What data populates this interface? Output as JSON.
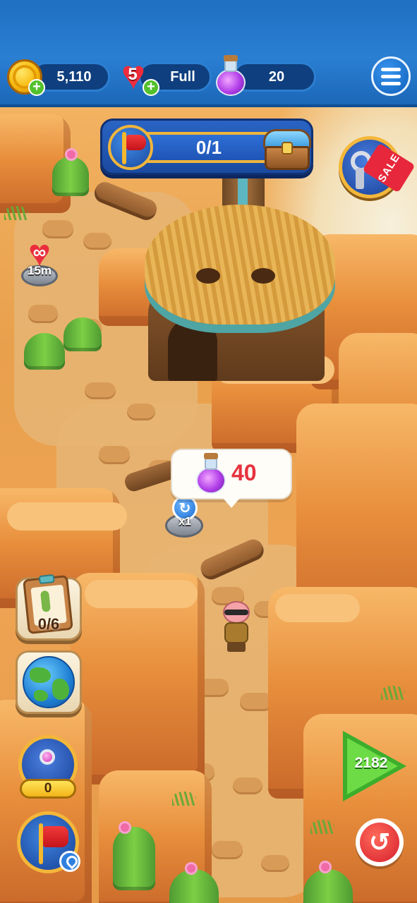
{
  "hud": {
    "coins": "5,110",
    "lives": "5",
    "lives_status": "Full",
    "potions": "20",
    "icons": {
      "coin": "coin-icon",
      "heart": "heart-icon",
      "potion": "potion-icon",
      "menu": "hamburger-menu-icon",
      "add": "plus-icon"
    }
  },
  "quest": {
    "progress": "0/1",
    "icons": {
      "flag": "red-flag-icon",
      "reward": "treasure-chest-icon"
    }
  },
  "sale": {
    "label": "SALE",
    "icon": "keys-icon"
  },
  "unlimited_lives": {
    "symbol": "∞",
    "time": "15m"
  },
  "map_node": {
    "counter": "x1",
    "icon": "refresh-icon"
  },
  "reward_bubble": {
    "amount": "40",
    "icon": "potion-icon"
  },
  "side_buttons": {
    "collection_progress": "0/6",
    "globe_icon": "globe-icon",
    "keys_count": "0",
    "flag_icon": "red-flag-icon",
    "location_icon": "location-pin-icon"
  },
  "play_button": {
    "level": "2182"
  },
  "back_button": {
    "icon": "undo-arrow-icon"
  },
  "colors": {
    "hud_blue": "#1f6fc2",
    "heart_red": "#ee2c3b",
    "play_green": "#3cae2c",
    "gold_border": "#f4b73a",
    "bubble_red_text": "#e6323e"
  }
}
